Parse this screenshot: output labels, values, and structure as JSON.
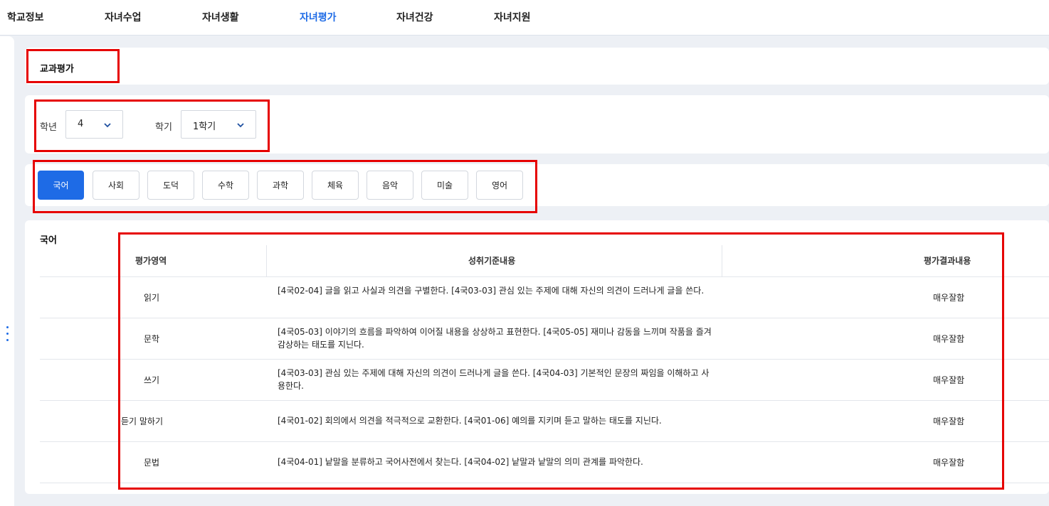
{
  "nav": [
    "학교정보",
    "자녀수업",
    "자녀생활",
    "자녀평가",
    "자녀건강",
    "자녀지원"
  ],
  "page_title": "교과평가",
  "filters": {
    "grade_label": "학년",
    "grade_value": "4",
    "semester_label": "학기",
    "semester_value": "1학기"
  },
  "subjects": [
    "국어",
    "사회",
    "도덕",
    "수학",
    "과학",
    "체육",
    "음악",
    "미술",
    "영어"
  ],
  "active_subject": "국어",
  "section_title": "국어",
  "table": {
    "headers": [
      "평가영역",
      "성취기준내용",
      "평가결과내용"
    ],
    "rows": [
      {
        "area": "읽기",
        "standard": "[4국02-04] 글을 읽고 사실과 의견을 구별한다. [4국03-03] 관심 있는 주제에 대해 자신의 의견이 드러나게 글을 쓴다.",
        "result": "매우잘함"
      },
      {
        "area": "문학",
        "standard": "[4국05-03] 이야기의 흐름을 파악하여 이어질 내용을 상상하고 표현한다. [4국05-05] 재미나 감동을 느끼며 작품을 즐겨 감상하는 태도를 지닌다.",
        "result": "매우잘함"
      },
      {
        "area": "쓰기",
        "standard": "[4국03-03] 관심 있는 주제에 대해 자신의 의견이 드러나게 글을 쓴다. [4국04-03] 기본적인 문장의 짜임을 이해하고 사용한다.",
        "result": "매우잘함"
      },
      {
        "area": "듣기 말하기",
        "standard": "[4국01-02] 회의에서 의견을 적극적으로 교환한다. [4국01-06] 예의를 지키며 듣고 말하는 태도를 지닌다.",
        "result": "매우잘함"
      },
      {
        "area": "문법",
        "standard": "[4국04-01] 낱말을 분류하고 국어사전에서 찾는다. [4국04-02] 낱말과 낱말의 의미 관계를 파악한다.",
        "result": "매우잘함"
      }
    ]
  },
  "colors": {
    "accent": "#1e6be6",
    "highlight": "#e60000"
  },
  "icons": {
    "dropdown": "chevron-down-icon",
    "more": "more-vertical-icon"
  }
}
